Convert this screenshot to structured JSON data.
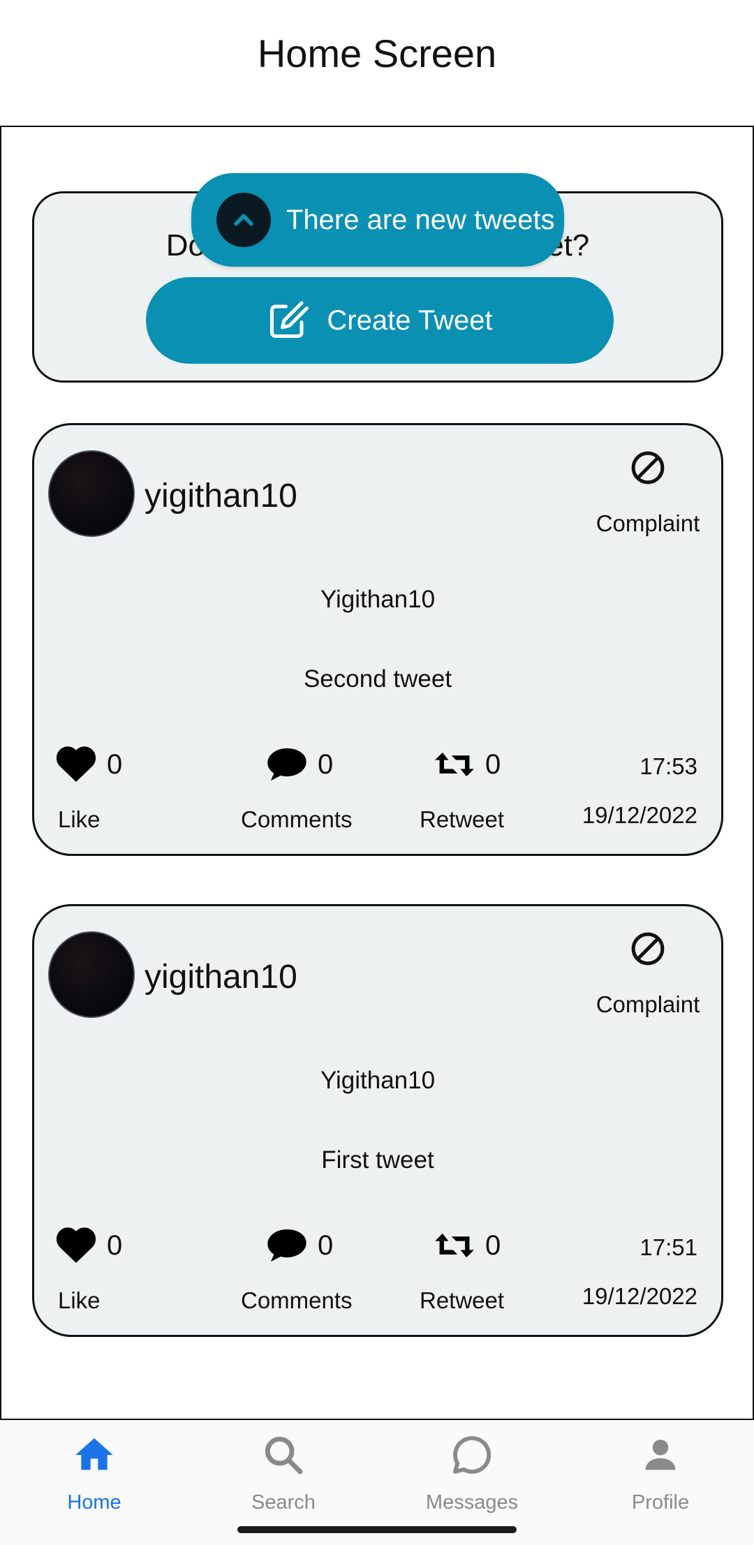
{
  "header": {
    "title": "Home Screen"
  },
  "create": {
    "question": "Do you want to create a tweet?",
    "button_label": "Create Tweet"
  },
  "banner": {
    "label": "There are new tweets"
  },
  "tweets": [
    {
      "username": "yigithan10",
      "complaint_label": "Complaint",
      "name": "Yigithan10",
      "text": "Second tweet",
      "likes": "0",
      "comments": "0",
      "retweets": "0",
      "like_label": "Like",
      "comments_label": "Comments",
      "retweet_label": "Retweet",
      "time": "17:53",
      "date": "19/12/2022"
    },
    {
      "username": "yigithan10",
      "complaint_label": "Complaint",
      "name": "Yigithan10",
      "text": "First tweet",
      "likes": "0",
      "comments": "0",
      "retweets": "0",
      "like_label": "Like",
      "comments_label": "Comments",
      "retweet_label": "Retweet",
      "time": "17:51",
      "date": "19/12/2022"
    }
  ],
  "nav": {
    "active_color": "#1a73e8",
    "inactive_color": "#8a8a8a",
    "items": [
      {
        "label": "Home",
        "icon": "home-icon",
        "active": true
      },
      {
        "label": "Search",
        "icon": "search-icon",
        "active": false
      },
      {
        "label": "Messages",
        "icon": "message-icon",
        "active": false
      },
      {
        "label": "Profile",
        "icon": "person-icon",
        "active": false
      }
    ]
  },
  "colors": {
    "accent": "#0a90b3",
    "card_bg": "#eef1f2"
  }
}
